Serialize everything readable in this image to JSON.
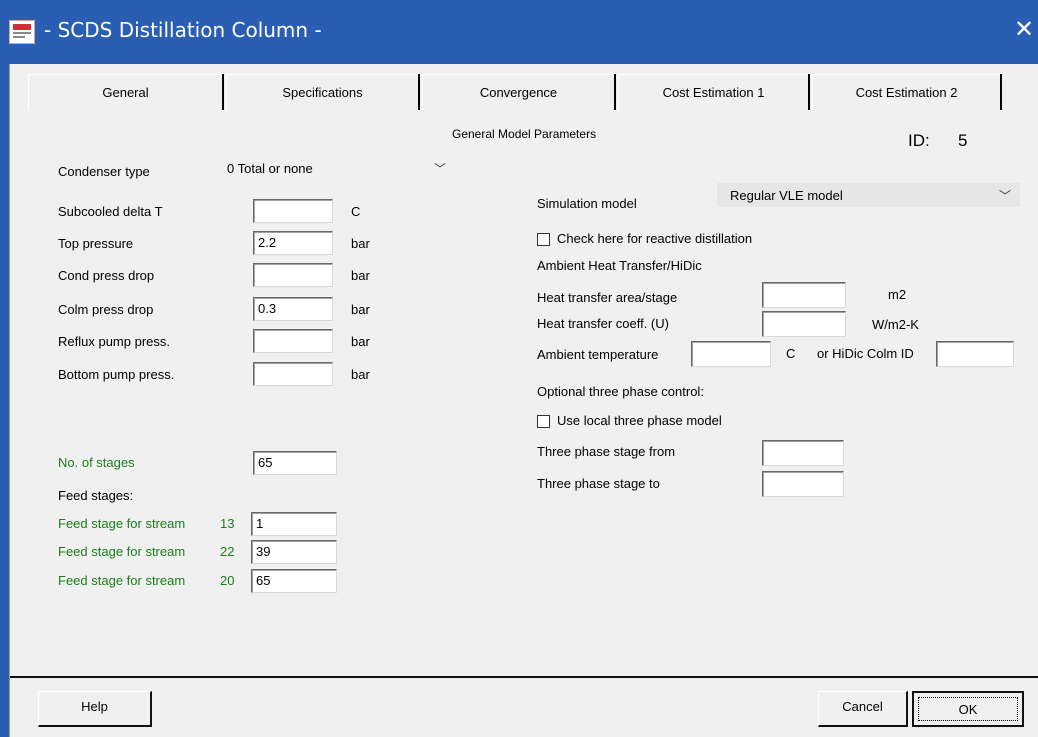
{
  "window": {
    "title": "- SCDS Distillation Column -"
  },
  "tabs": [
    "General",
    "Specifications",
    "Convergence",
    "Cost Estimation 1",
    "Cost Estimation 2"
  ],
  "header": {
    "section_title": "General Model Parameters",
    "id_label": "ID:",
    "id_value": "5"
  },
  "left": {
    "condenser_type_label": "Condenser type",
    "condenser_type_value": "0 Total or none",
    "rows": [
      {
        "label": "Subcooled delta T",
        "value": "",
        "unit": "C"
      },
      {
        "label": "Top pressure",
        "value": "2.2",
        "unit": "bar"
      },
      {
        "label": "Cond press drop",
        "value": "",
        "unit": "bar"
      },
      {
        "label": "Colm press drop",
        "value": "0.3",
        "unit": "bar"
      },
      {
        "label": "Reflux pump press.",
        "value": "",
        "unit": "bar"
      },
      {
        "label": "Bottom pump press.",
        "value": "",
        "unit": "bar"
      }
    ],
    "stages_label": "No. of stages",
    "stages_value": "65",
    "feed_stages_label": "Feed stages:",
    "feeds": [
      {
        "label": "Feed stage for stream",
        "stream": "13",
        "value": "1"
      },
      {
        "label": "Feed stage for stream",
        "stream": "22",
        "value": "39"
      },
      {
        "label": "Feed stage for stream",
        "stream": "20",
        "value": "65"
      }
    ]
  },
  "right": {
    "sim_model_label": "Simulation model",
    "sim_model_value": "Regular VLE model",
    "reactive_check_label": "Check here for reactive distillation",
    "ambient_title": "Ambient Heat Transfer/HiDic",
    "ht_area_label": "Heat transfer area/stage",
    "ht_area_value": "",
    "ht_area_unit": "m2",
    "ht_coeff_label": "Heat transfer coeff. (U)",
    "ht_coeff_value": "",
    "ht_coeff_unit": "W/m2-K",
    "amb_temp_label": "Ambient temperature",
    "amb_temp_value": "",
    "amb_temp_unit": "C",
    "hidic_label": "or HiDic Colm ID",
    "hidic_value": "",
    "three_phase_title": "Optional three phase control:",
    "local_three_phase_label": "Use local three phase model",
    "three_phase_from_label": "Three phase stage from",
    "three_phase_from_value": "",
    "three_phase_to_label": "Three phase stage to",
    "three_phase_to_value": ""
  },
  "footer": {
    "help": "Help",
    "cancel": "Cancel",
    "ok": "OK"
  }
}
